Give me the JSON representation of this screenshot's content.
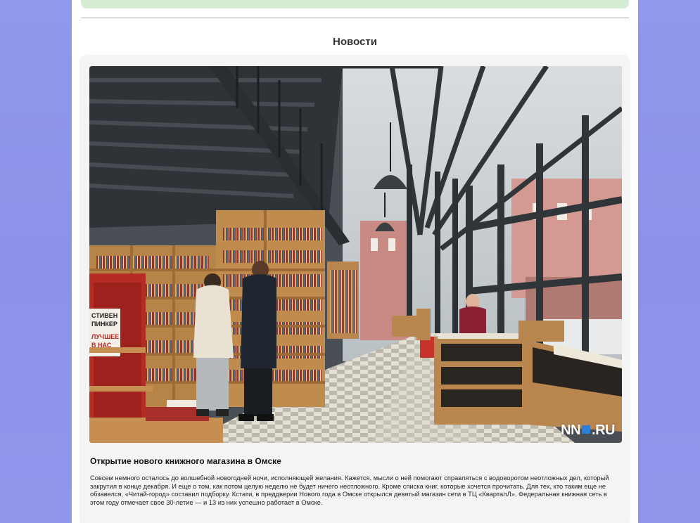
{
  "section": {
    "title": "Новости"
  },
  "news": {
    "headline": "Открытие нового книжного магазина в Омске",
    "body": "Совсем немного осталось до волшебной новогодней ночи, исполняющей желания. Кажется, мысли о ней помогают справляться с водоворотом неотложных дел, который закрутил в конце декабря. И еще о том, как потом целую неделю не будет ничего неотложного. Кроме списка книг, которые хочется прочитать. Для тех, кто таким еще не обзавелся, «Читай-город» составил подборку. Кстати, в преддверии Нового года в Омске открылся девятый магазин сети в ТЦ «КварталЛ». Федеральная книжная сеть в этом году отмечает свое 30-летие — и 13 из них успешно работает в Омске.",
    "image": {
      "watermark_left": "NN",
      "watermark_right": "RU",
      "book_cover_line1": "СТИВЕН",
      "book_cover_line2": "ПИНКЕР",
      "book_cover_line3": "ЛУЧШЕЕ",
      "book_cover_line4": "В НАС"
    }
  },
  "colors": {
    "page_bg": "#8f98ea",
    "banner": "#d3ecd3",
    "card_bg": "#f4f4f4",
    "watermark_accent": "#2a7fd9"
  }
}
